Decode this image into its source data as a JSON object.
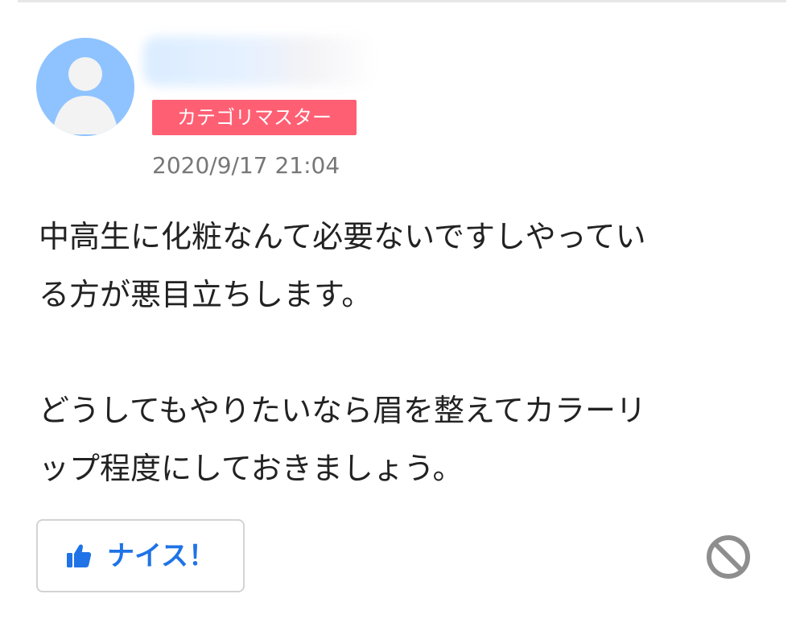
{
  "answer": {
    "user": {
      "badge": "カテゴリマスター"
    },
    "timestamp": "2020/9/17 21:04",
    "body": {
      "lines": [
        "中高生に化粧なんて必要ないですしやってい",
        "る方が悪目立ちします。",
        "",
        "どうしてもやりたいなら眉を整えてカラーリ",
        "ップ程度にしておきましょう。"
      ]
    },
    "actions": {
      "nice_label": "ナイス！",
      "nice_icon": "thumbs-up-icon",
      "report_icon": "no-entry-icon"
    }
  },
  "colors": {
    "badge_background": "#ff5f73",
    "link_blue": "#1f73e6",
    "muted_text": "#777777",
    "avatar_background": "#8fc3ff"
  }
}
